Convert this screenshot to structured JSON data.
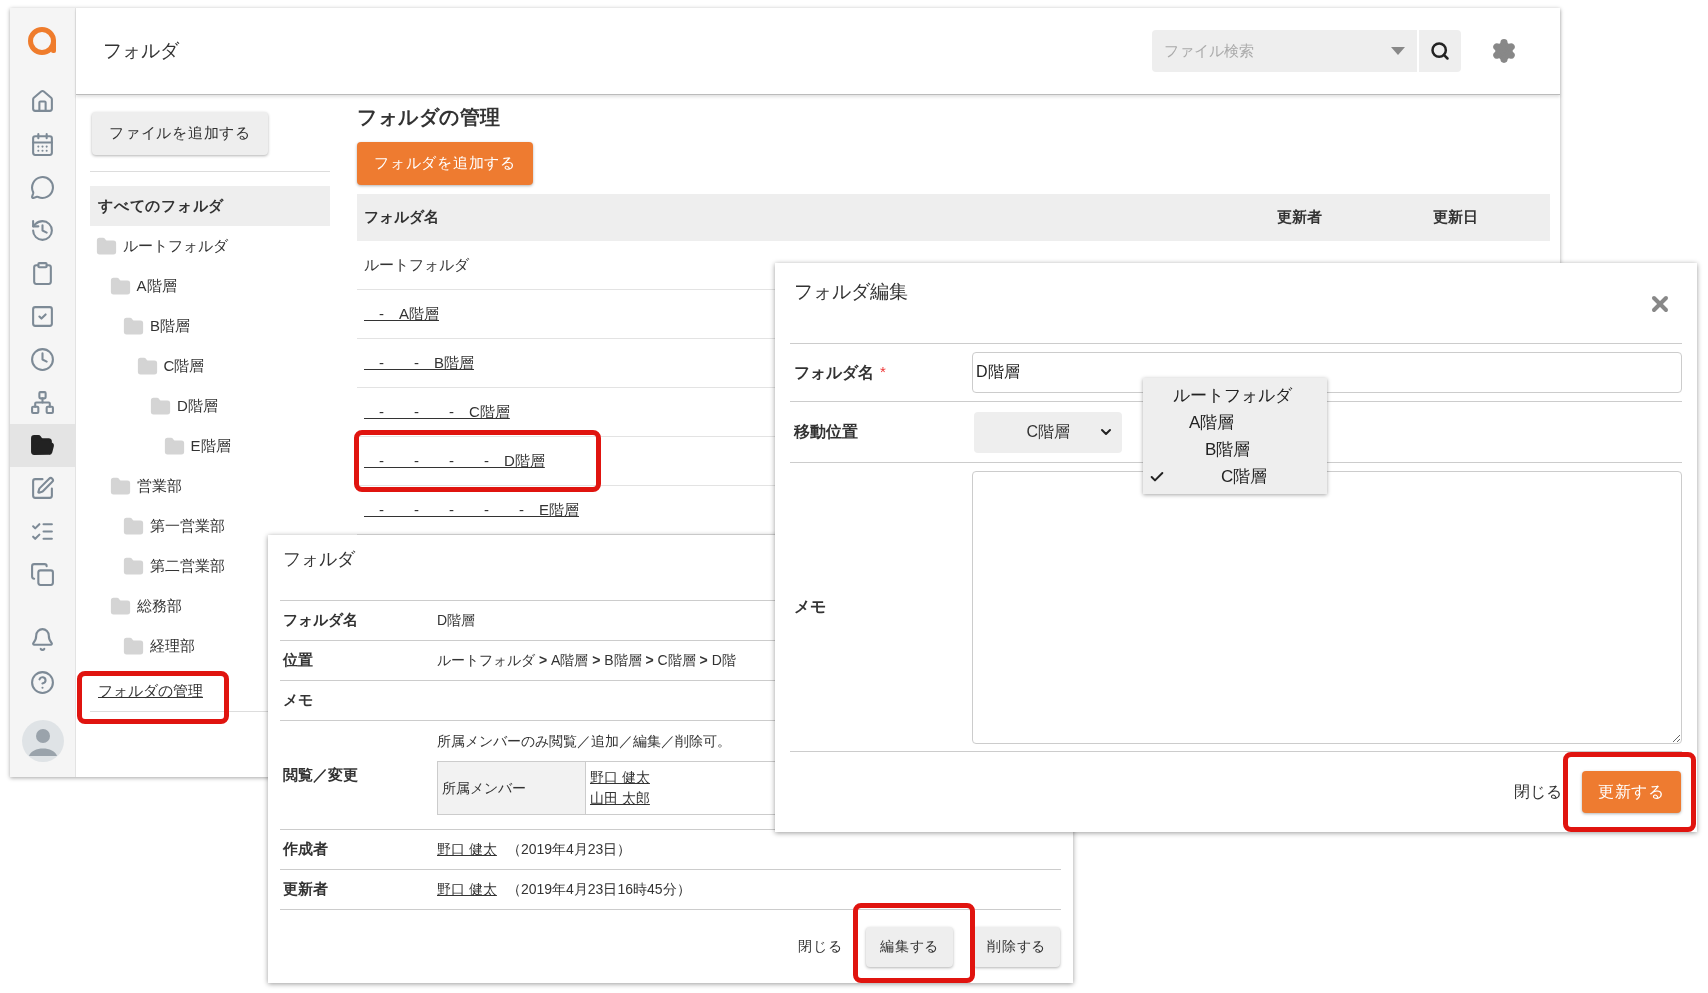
{
  "app": {
    "header_title": "フォルダ",
    "search": {
      "placeholder": "ファイル検索"
    },
    "nav": [
      {
        "selected": false
      },
      {
        "selected": false
      },
      {
        "selected": false
      },
      {
        "selected": false
      },
      {
        "selected": false
      },
      {
        "selected": false
      },
      {
        "selected": false
      },
      {
        "selected": false
      },
      {
        "selected": true
      },
      {
        "selected": false
      },
      {
        "selected": false
      },
      {
        "selected": false
      },
      {
        "selected": false
      },
      {
        "selected": false
      }
    ],
    "add_file_button": "ファイルを追加する",
    "folder_tree": {
      "all_label": "すべてのフォルダ",
      "all_selected": true,
      "items": [
        {
          "label": "ルートフォルダ",
          "children": [
            {
              "label": "A階層",
              "children": [
                {
                  "label": "B階層",
                  "children": [
                    {
                      "label": "C階層",
                      "children": [
                        {
                          "label": "D階層",
                          "children": [
                            {
                              "label": "E階層"
                            }
                          ]
                        }
                      ]
                    }
                  ]
                }
              ]
            },
            {
              "label": "営業部",
              "children": [
                {
                  "label": "第一営業部"
                },
                {
                  "label": "第二営業部"
                }
              ]
            },
            {
              "label": "総務部",
              "children": [
                {
                  "label": "経理部"
                }
              ]
            }
          ]
        }
      ]
    },
    "manage_link": "フォルダの管理",
    "content": {
      "title": "フォルダの管理",
      "add_button": "フォルダを追加する",
      "table": {
        "columns": [
          "フォルダ名",
          "更新者",
          "更新日"
        ],
        "rows": [
          {
            "kind": "plain",
            "name": "ルートフォルダ"
          },
          {
            "kind": "link",
            "name": "　-　A階層"
          },
          {
            "kind": "link",
            "name": "　-　　-　B階層"
          },
          {
            "kind": "link",
            "name": "　-　　-　　-　C階層"
          },
          {
            "kind": "link",
            "name": "　-　　-　　-　　-　D階層"
          },
          {
            "kind": "link",
            "name": "　-　　-　　-　　-　　-　E階層"
          }
        ]
      }
    }
  },
  "folder_dialog": {
    "title": "フォルダ",
    "fields": [
      {
        "kind": "text",
        "label": "フォルダ名",
        "value": "D階層"
      },
      {
        "kind": "text",
        "label": "位置",
        "value": "ルートフォルダ **>** A階層 **>** B階層 **>** C階層 **>** D階"
      },
      {
        "kind": "text",
        "label": "メモ"
      },
      {
        "kind": "permission",
        "label": "閲覧／変更",
        "note": "所属メンバーのみ閲覧／追加／編集／削除可。",
        "members_label": "所属メンバー",
        "members": [
          "野口 健太",
          "山田 太郎"
        ]
      },
      {
        "kind": "user",
        "label": "作成者",
        "user": "野口 健太",
        "detail": "（2019年4月23日）"
      },
      {
        "kind": "user",
        "label": "更新者",
        "user": "野口 健太",
        "detail": "（2019年4月23日16時45分）"
      }
    ],
    "buttons": [
      {
        "kind": "text",
        "label": "閉じる"
      },
      {
        "kind": "raised",
        "label": "編集する"
      },
      {
        "kind": "raised",
        "label": "削除する"
      }
    ]
  },
  "edit_dialog": {
    "title": "フォルダ編集",
    "name_label": "フォルダ名",
    "required_mark": "*",
    "name_value": "D階層",
    "move_label": "移動位置",
    "move_value": "C階層",
    "memo_label": "メモ",
    "close": "閉じる",
    "submit": "更新する",
    "dropdown": [
      {
        "label": "ルートフォルダ",
        "selected": false,
        "children": [
          {
            "label": "A階層",
            "selected": false,
            "children": [
              {
                "label": "B階層",
                "selected": false,
                "children": [
                  {
                    "label": "C階層",
                    "selected": true
                  }
                ]
              }
            ]
          }
        ]
      }
    ]
  }
}
